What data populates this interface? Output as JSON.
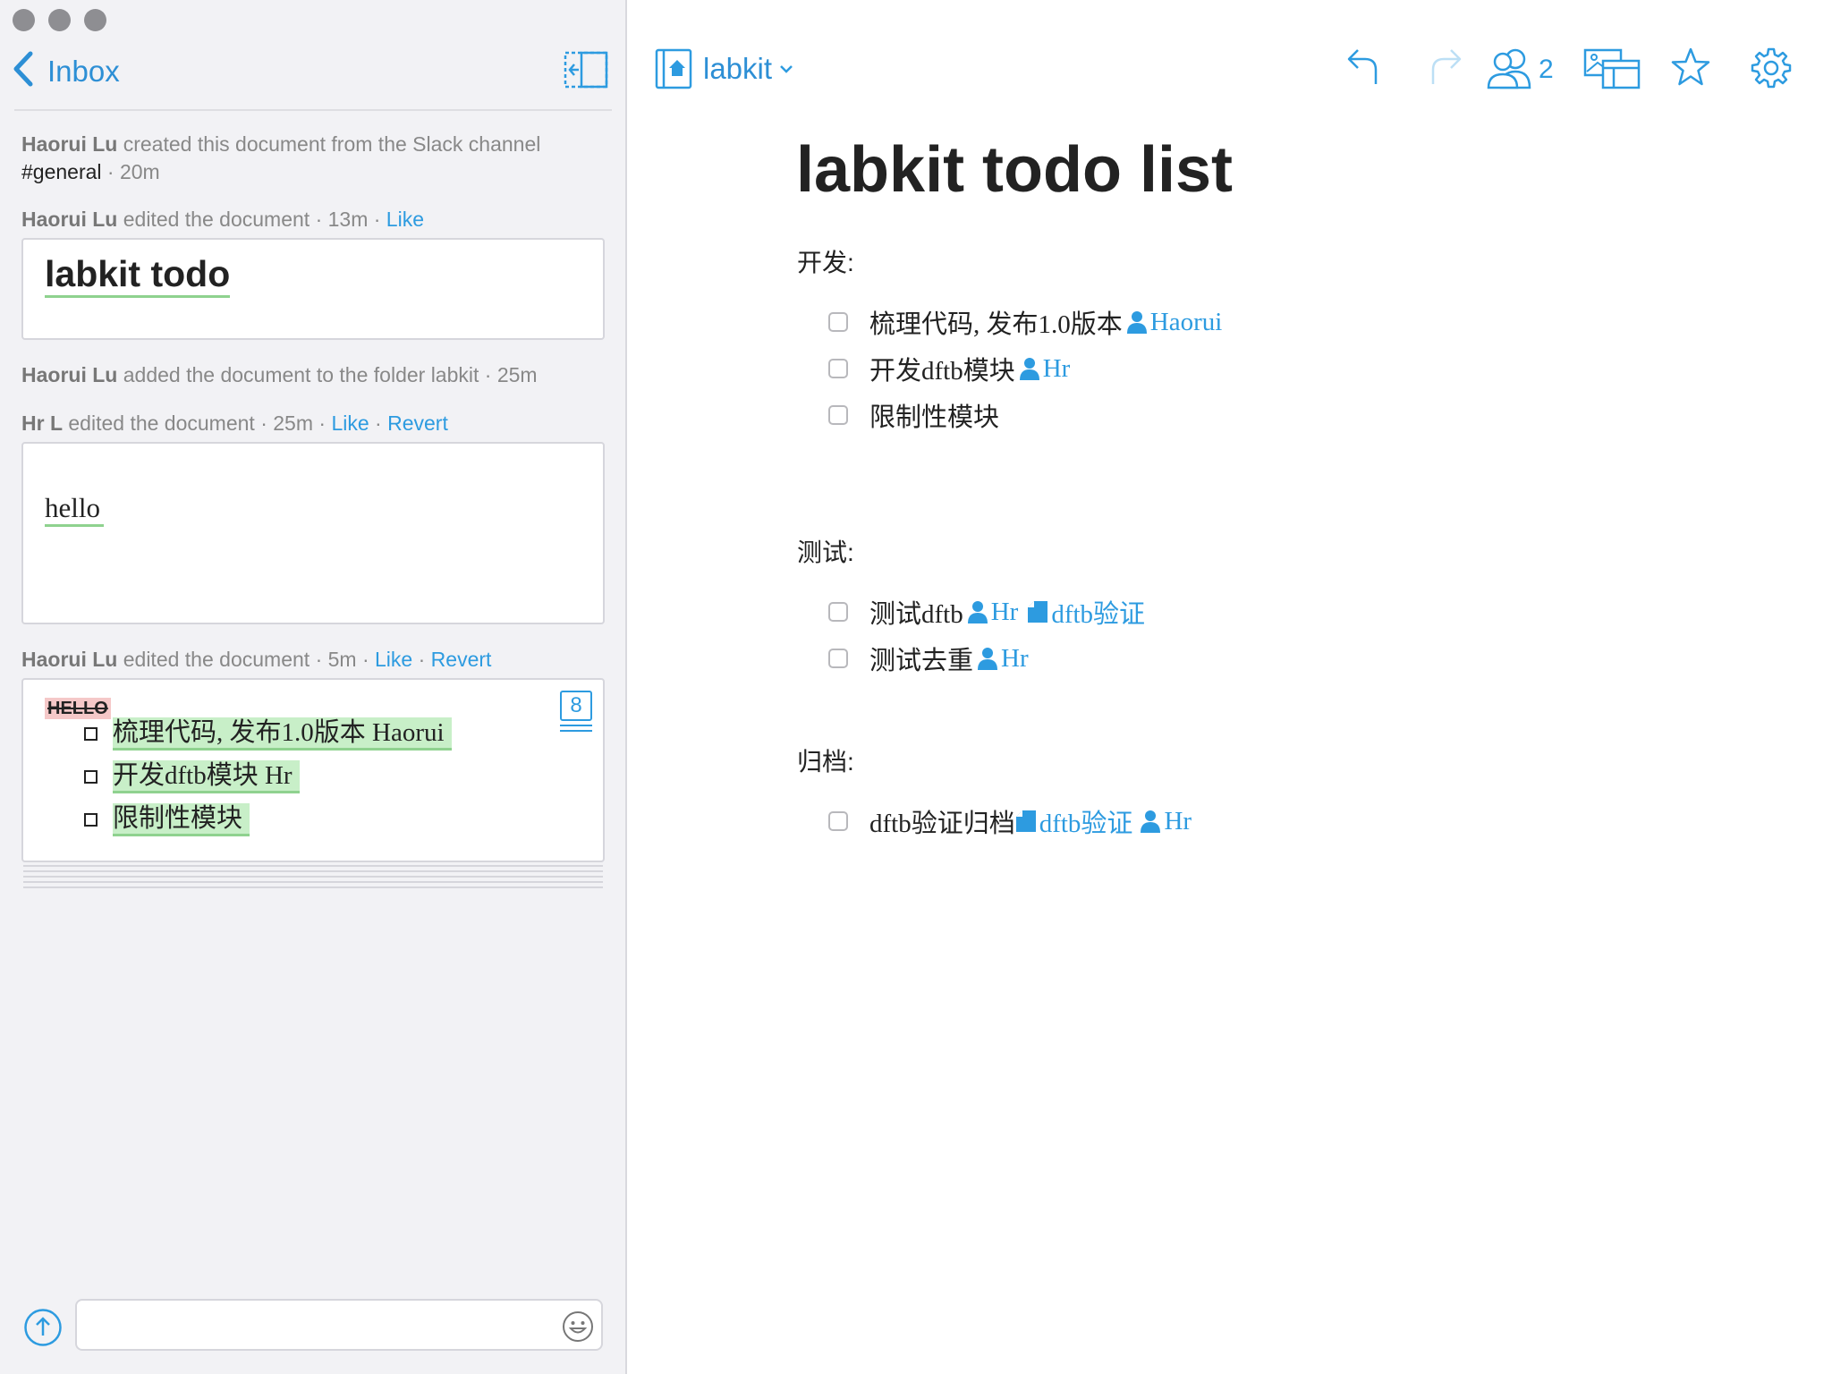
{
  "sidebar": {
    "back_label": "Inbox",
    "activity": [
      {
        "author": "Haorui Lu",
        "text": "created this document from the Slack channel",
        "channel": "#general",
        "time": "· 20m"
      },
      {
        "author": "Haorui Lu",
        "text": "edited the document",
        "time": "· 13m ·",
        "like": "Like"
      },
      {
        "author": "Haorui Lu",
        "text": "added the document to the folder labkit",
        "time": "· 25m"
      },
      {
        "author": "Hr L",
        "text": "edited the document",
        "time": "· 25m ·",
        "like": "Like",
        "sep": "·",
        "revert": "Revert"
      },
      {
        "author": "Haorui Lu",
        "text": "edited the document",
        "time": "· 5m ·",
        "like": "Like",
        "sep": "·",
        "revert": "Revert"
      }
    ],
    "card1": {
      "title": "labkit todo"
    },
    "card2": {
      "text": "hello"
    },
    "card3": {
      "deleted": "HELLO",
      "badge": "8",
      "items": [
        "梳理代码, 发布1.0版本 Haorui",
        "开发dftb模块 Hr",
        "限制性模块"
      ]
    },
    "composer": {
      "placeholder": ""
    }
  },
  "header": {
    "folder": "labkit",
    "collaborators_count": "2"
  },
  "document": {
    "title": "labkit todo list",
    "sections": [
      {
        "heading": "开发:",
        "items": [
          {
            "text": "梳理代码, 发布1.0版本",
            "mention": "Haorui"
          },
          {
            "text": "开发dftb模块",
            "mention": "Hr"
          },
          {
            "text": "限制性模块"
          }
        ]
      },
      {
        "heading": "测试:",
        "items": [
          {
            "text": "测试dftb",
            "mention": "Hr",
            "link": "dftb验证"
          },
          {
            "text": "测试去重",
            "mention": "Hr"
          }
        ]
      },
      {
        "heading": "归档:",
        "items": [
          {
            "text": "dftb验证归档",
            "link": "dftb验证",
            "mention": "Hr"
          }
        ]
      }
    ]
  },
  "colors": {
    "accent": "#2d9be0",
    "sidebar_bg": "#f2f2f5",
    "added": "#c8efc8",
    "removed": "#f5c8c8"
  }
}
